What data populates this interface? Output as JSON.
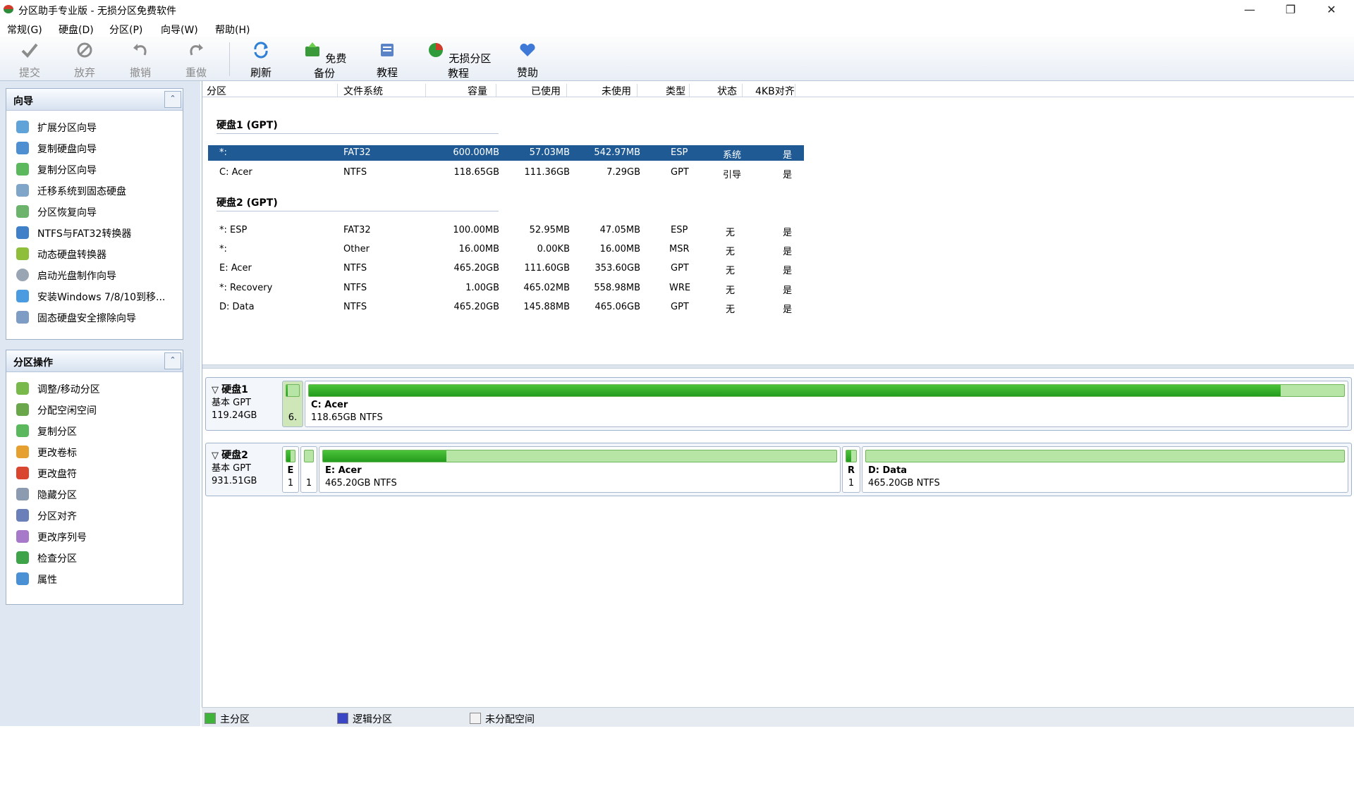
{
  "window": {
    "title": "分区助手专业版 - 无损分区免费软件"
  },
  "menu": [
    "常规(G)",
    "硬盘(D)",
    "分区(P)",
    "向导(W)",
    "帮助(H)"
  ],
  "toolbar": {
    "submit": "提交",
    "discard": "放弃",
    "undo": "撤销",
    "redo": "重做",
    "refresh": "刷新",
    "backup": "免费备份",
    "tutorial": "教程",
    "lossless": "无损分区教程",
    "donate": "赞助"
  },
  "wizard_panel": {
    "title": "向导",
    "items": [
      "扩展分区向导",
      "复制硬盘向导",
      "复制分区向导",
      "迁移系统到固态硬盘",
      "分区恢复向导",
      "NTFS与FAT32转换器",
      "动态硬盘转换器",
      "启动光盘制作向导",
      "安装Windows 7/8/10到移...",
      "固态硬盘安全擦除向导"
    ]
  },
  "ops_panel": {
    "title": "分区操作",
    "items": [
      "调整/移动分区",
      "分配空闲空间",
      "复制分区",
      "更改卷标",
      "更改盘符",
      "隐藏分区",
      "分区对齐",
      "更改序列号",
      "检查分区",
      "属性"
    ]
  },
  "columns": [
    "分区",
    "文件系统",
    "容量",
    "已使用",
    "未使用",
    "类型",
    "状态",
    "4KB对齐"
  ],
  "disk1": {
    "header": "硬盘1 (GPT)",
    "rows": [
      {
        "name": "*:",
        "fs": "FAT32",
        "cap": "600.00MB",
        "used": "57.03MB",
        "free": "542.97MB",
        "type": "ESP",
        "status": "系统",
        "align": "是"
      },
      {
        "name": "C: Acer",
        "fs": "NTFS",
        "cap": "118.65GB",
        "used": "111.36GB",
        "free": "7.29GB",
        "type": "GPT",
        "status": "引导",
        "align": "是"
      }
    ]
  },
  "disk2": {
    "header": "硬盘2 (GPT)",
    "rows": [
      {
        "name": "*: ESP",
        "fs": "FAT32",
        "cap": "100.00MB",
        "used": "52.95MB",
        "free": "47.05MB",
        "type": "ESP",
        "status": "无",
        "align": "是"
      },
      {
        "name": "*:",
        "fs": "Other",
        "cap": "16.00MB",
        "used": "0.00KB",
        "free": "16.00MB",
        "type": "MSR",
        "status": "无",
        "align": "是"
      },
      {
        "name": "E: Acer",
        "fs": "NTFS",
        "cap": "465.20GB",
        "used": "111.60GB",
        "free": "353.60GB",
        "type": "GPT",
        "status": "无",
        "align": "是"
      },
      {
        "name": "*: Recovery",
        "fs": "NTFS",
        "cap": "1.00GB",
        "used": "465.02MB",
        "free": "558.98MB",
        "type": "WRE",
        "status": "无",
        "align": "是"
      },
      {
        "name": "D: Data",
        "fs": "NTFS",
        "cap": "465.20GB",
        "used": "145.88MB",
        "free": "465.06GB",
        "type": "GPT",
        "status": "无",
        "align": "是"
      }
    ]
  },
  "map": {
    "d1": {
      "name": "硬盘1",
      "kind": "基本 GPT",
      "size": "119.24GB",
      "p1_label": "6.",
      "p1_used": 0.095,
      "p2_name": "C: Acer",
      "p2_info": "118.65GB NTFS",
      "p2_used": 0.939
    },
    "d2": {
      "name": "硬盘2",
      "kind": "基本 GPT",
      "size": "931.51GB",
      "p1_label": "E",
      "p1_sub": "1",
      "p1_used": 0.53,
      "p2_sub": "1",
      "p2_used": 0.0,
      "p3_name": "E: Acer",
      "p3_info": "465.20GB NTFS",
      "p3_used": 0.24,
      "p4_label": "R",
      "p4_sub": "1",
      "p4_used": 0.465,
      "p5_name": "D: Data",
      "p5_info": "465.20GB NTFS",
      "p5_used": 0.0003
    }
  },
  "legend": {
    "primary": "主分区",
    "logical": "逻辑分区",
    "unallocated": "未分配空间"
  },
  "colors": {
    "primary": "#3fb33a",
    "logical": "#3b46c4",
    "unallocated": "#f2f2f2",
    "selection": "#1f5a94"
  }
}
